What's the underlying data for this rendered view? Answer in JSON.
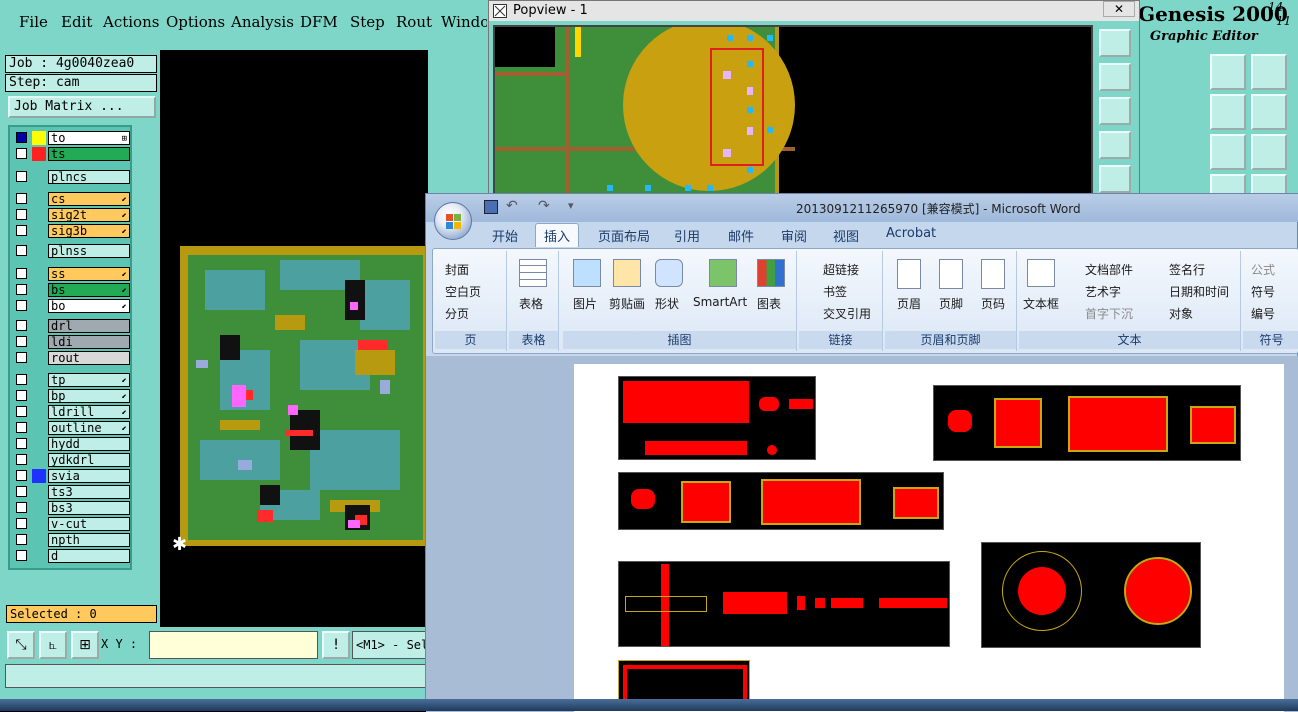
{
  "genesis": {
    "menu": [
      "File",
      "Edit",
      "Actions",
      "Options",
      "Analysis",
      "DFM",
      "Step",
      "Rout",
      "Window"
    ],
    "job_label": "Job : 4g0040zea0",
    "step_label": "Step: cam",
    "job_matrix": "Job Matrix ...",
    "layers": [
      {
        "name": "to",
        "color": "#ffffff",
        "swatch": "#ffff00",
        "mark": "#0000aa",
        "arrow": "⊞"
      },
      {
        "name": "ts",
        "color": "#22aa55",
        "swatch": "#ff2020",
        "arrow": ""
      },
      {
        "name": "plncs",
        "color": "#bfeee6",
        "swatch": "",
        "arrow": ""
      },
      {
        "name": "cs",
        "color": "#ffc95e",
        "swatch": "",
        "arrow": "⬋"
      },
      {
        "name": "sig2t",
        "color": "#ffc95e",
        "swatch": "",
        "arrow": "⬋"
      },
      {
        "name": "sig3b",
        "color": "#ffc95e",
        "swatch": "",
        "arrow": "⬋"
      },
      {
        "name": "plnss",
        "color": "#bfeee6",
        "swatch": "",
        "arrow": ""
      },
      {
        "name": "ss",
        "color": "#ffc95e",
        "swatch": "",
        "arrow": "⬋"
      },
      {
        "name": "bs",
        "color": "#22aa55",
        "swatch": "",
        "arrow": "⬋"
      },
      {
        "name": "bo",
        "color": "#ffffff",
        "swatch": "",
        "arrow": "⬋"
      },
      {
        "name": "drl",
        "color": "#a0a8b0",
        "swatch": "",
        "arrow": ""
      },
      {
        "name": "ldi",
        "color": "#a0a8b0",
        "swatch": "",
        "arrow": ""
      },
      {
        "name": "rout",
        "color": "#d8d8d8",
        "swatch": "",
        "arrow": ""
      },
      {
        "name": "tp",
        "color": "#bfeee6",
        "swatch": "",
        "arrow": "⬋"
      },
      {
        "name": "bp",
        "color": "#bfeee6",
        "swatch": "",
        "arrow": "⬋"
      },
      {
        "name": "ldrill",
        "color": "#bfeee6",
        "swatch": "",
        "arrow": "⬋"
      },
      {
        "name": "outline",
        "color": "#bfeee6",
        "swatch": "",
        "arrow": "⬋"
      },
      {
        "name": "hydd",
        "color": "#bfeee6",
        "swatch": "",
        "arrow": ""
      },
      {
        "name": "ydkdrl",
        "color": "#bfeee6",
        "swatch": "",
        "arrow": ""
      },
      {
        "name": "svia",
        "color": "#bfeee6",
        "swatch": "#2030ff",
        "arrow": ""
      },
      {
        "name": "ts3",
        "color": "#bfeee6",
        "swatch": "",
        "arrow": ""
      },
      {
        "name": "bs3",
        "color": "#bfeee6",
        "swatch": "",
        "arrow": ""
      },
      {
        "name": "v-cut",
        "color": "#bfeee6",
        "swatch": "",
        "arrow": ""
      },
      {
        "name": "npth",
        "color": "#bfeee6",
        "swatch": "",
        "arrow": ""
      },
      {
        "name": "d",
        "color": "#bfeee6",
        "swatch": "",
        "arrow": ""
      }
    ],
    "selected": "Selected : 0",
    "xy_label": "X Y :",
    "status_text": "<M1> - Sel",
    "title_main": "Genesis 2000",
    "title_sub": "Graphic Editor",
    "title_date_top": "14",
    "title_date_bottom": "11"
  },
  "popview": {
    "title": "Popview - 1",
    "close": "✕"
  },
  "word": {
    "title": "2013091211265970 [兼容模式] - Microsoft Word",
    "tabs": [
      "开始",
      "插入",
      "页面布局",
      "引用",
      "邮件",
      "审阅",
      "视图",
      "Acrobat"
    ],
    "active_tab": "插入",
    "groups": {
      "pages": {
        "label": "页",
        "items": [
          "封面",
          "空白页",
          "分页"
        ]
      },
      "table": {
        "label": "表格",
        "items": [
          "表格"
        ]
      },
      "illustrations": {
        "label": "插图",
        "items": [
          "图片",
          "剪贴画",
          "形状",
          "SmartArt",
          "图表"
        ]
      },
      "links": {
        "label": "链接",
        "items": [
          "超链接",
          "书签",
          "交叉引用"
        ]
      },
      "header_footer": {
        "label": "页眉和页脚",
        "items": [
          "页眉",
          "页脚",
          "页码"
        ]
      },
      "text": {
        "label": "文本",
        "items": [
          "文本框",
          "文档部件",
          "艺术字",
          "首字下沉",
          "签名行",
          "日期和时间",
          "对象"
        ]
      },
      "symbols": {
        "label": "符号",
        "items": [
          "公式",
          "符号",
          "编号"
        ]
      }
    },
    "accent": "#ff0000"
  }
}
